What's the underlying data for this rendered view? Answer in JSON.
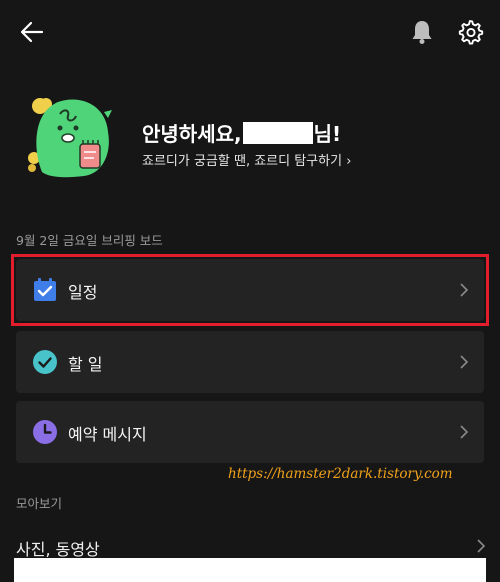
{
  "greeting": {
    "prefix": "안녕하세요,",
    "suffix": "님!",
    "explore_link": "죠르디가 궁금할 땐, 죠르디 탐구하기"
  },
  "briefing": {
    "date_label": "9월 2일 금요일 브리핑 보드",
    "items": [
      {
        "label": "일정",
        "icon": "calendar-check-icon"
      },
      {
        "label": "할 일",
        "icon": "check-circle-icon"
      },
      {
        "label": "예약 메시지",
        "icon": "clock-icon"
      }
    ]
  },
  "collection": {
    "label": "모아보기",
    "items": [
      {
        "label": "사진, 동영상"
      }
    ]
  },
  "watermark": "https://hamster2dark.tistory.com",
  "colors": {
    "background": "#161616",
    "card": "#232323",
    "highlight": "#e21d2c",
    "calendar": "#3f7ee8",
    "todo": "#48c3c9",
    "reserve": "#8a6ee6",
    "mascot": "#4fd47a",
    "watermark": "#f1a21a"
  }
}
